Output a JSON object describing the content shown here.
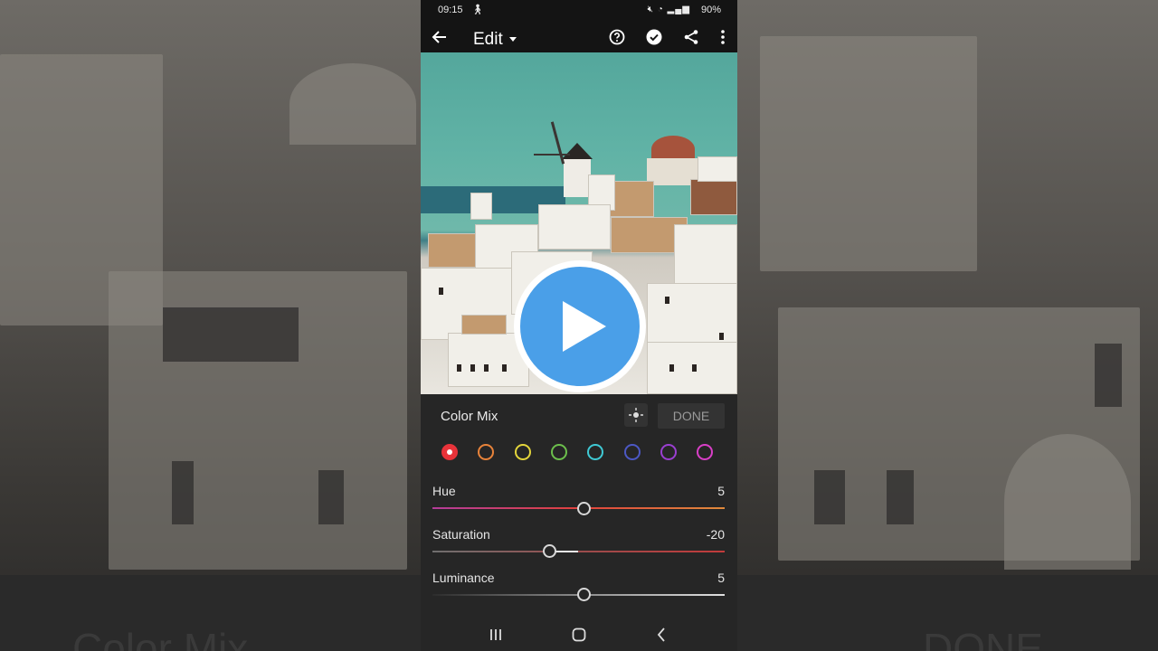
{
  "status_bar": {
    "time": "09:15",
    "battery": "90%"
  },
  "top_bar": {
    "title": "Edit"
  },
  "panel": {
    "title": "Color Mix",
    "done_label": "DONE",
    "swatch_colors": [
      "#e8333a",
      "#e8833a",
      "#e3d53b",
      "#6cbf4c",
      "#3fc9d4",
      "#4c58c4",
      "#9a3fd1",
      "#d93fc7"
    ],
    "selected_swatch": "red",
    "sliders": [
      {
        "label": "Hue",
        "value": "5",
        "fraction": 0.52
      },
      {
        "label": "Saturation",
        "value": "-20",
        "fraction": 0.4
      },
      {
        "label": "Luminance",
        "value": "5",
        "fraction": 0.52
      }
    ]
  },
  "background": {
    "title_left": "Color Mix",
    "title_right": "DONE"
  },
  "icons": [
    "back-arrow-icon",
    "help-icon",
    "checkmark-icon",
    "share-icon",
    "more-icon",
    "target-adjust-icon",
    "play-icon",
    "recent-apps-icon",
    "home-icon",
    "back-icon"
  ],
  "accent": "#4a9fe8"
}
